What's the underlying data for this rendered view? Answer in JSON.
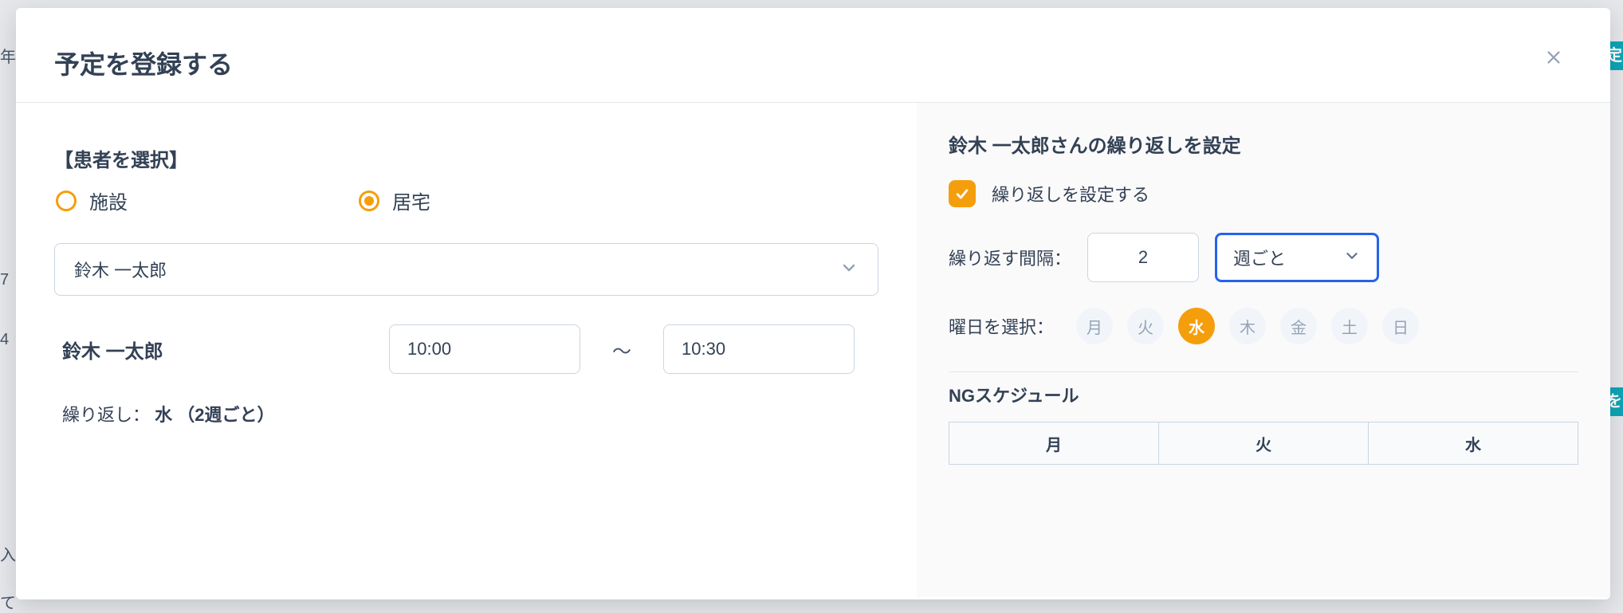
{
  "bg": {
    "left_chars": [
      "年",
      "7",
      "4",
      "入",
      "て"
    ],
    "right_label1": "定",
    "right_label2": "を"
  },
  "modal": {
    "title": "予定を登録する"
  },
  "patient_select": {
    "section_label": "【患者を選択】",
    "radio1": "施設",
    "radio2": "居宅",
    "selected_value": "鈴木 一太郎"
  },
  "schedule": {
    "patient_name": "鈴木 一太郎",
    "start_time": "10:00",
    "time_sep": "〜",
    "end_time": "10:30",
    "repeat_prefix": "繰り返し：",
    "repeat_value": "水 （2週ごと）"
  },
  "recurrence": {
    "title": "鈴木 一太郎さんの繰り返しを設定",
    "checkbox_label": "繰り返しを設定する",
    "interval_label": "繰り返す間隔：",
    "interval_value": "2",
    "interval_unit": "週ごと",
    "day_label": "曜日を選択：",
    "days": [
      "月",
      "火",
      "水",
      "木",
      "金",
      "土",
      "日"
    ],
    "active_day_index": 2
  },
  "ng": {
    "title": "NGスケジュール",
    "headers": [
      "月",
      "火",
      "水"
    ]
  }
}
